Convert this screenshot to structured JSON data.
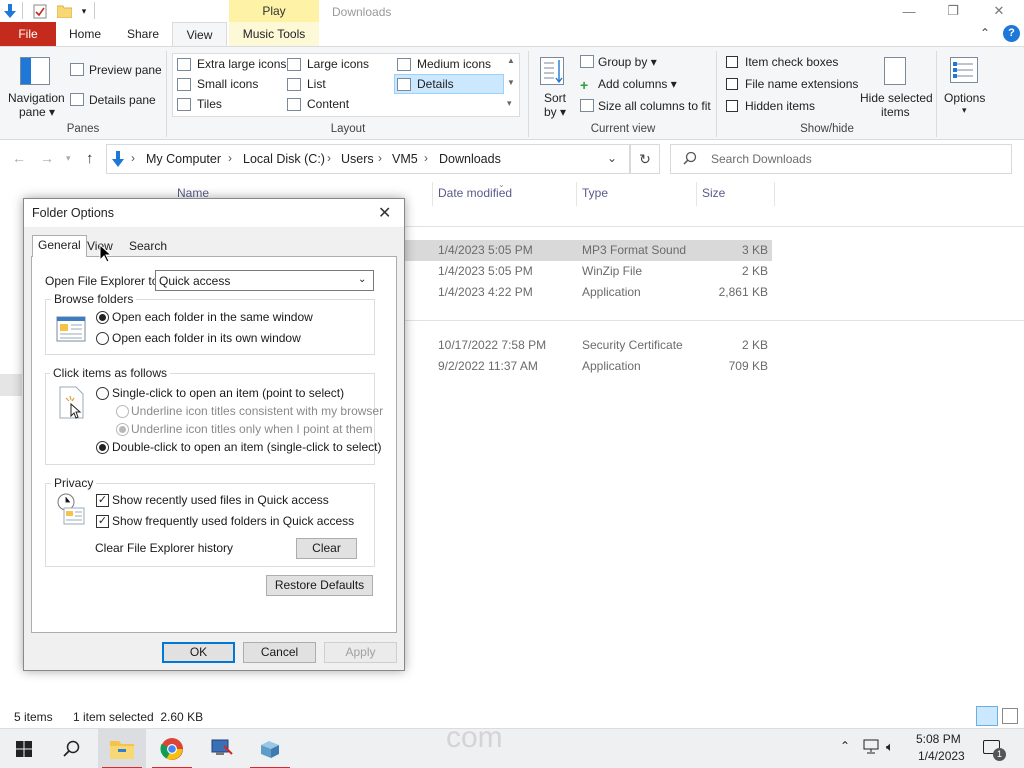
{
  "window": {
    "title": "Downloads",
    "contextual_tab_header": "Play",
    "minimize_icon": "—",
    "maximize_icon": "❐",
    "close_icon": "✕"
  },
  "ribbon_tabs": [
    "File",
    "Home",
    "Share",
    "View",
    "Music Tools"
  ],
  "ribbon": {
    "panes": {
      "group": "Panes",
      "navigation_pane": "Navigation\npane ▾",
      "navigation_pane_line1": "Navigation",
      "navigation_pane_line2": "pane ▾",
      "preview_pane": "Preview pane",
      "details_pane": "Details pane"
    },
    "layout": {
      "group": "Layout",
      "items": [
        "Extra large icons",
        "Large icons",
        "Medium icons",
        "Small icons",
        "List",
        "Details",
        "Tiles",
        "Content"
      ]
    },
    "current_view": {
      "group": "Current view",
      "sort_by_line1": "Sort",
      "sort_by_line2": "by ▾",
      "group_by": "Group by ▾",
      "add_columns": "Add columns ▾",
      "size_columns": "Size all columns to fit"
    },
    "show_hide": {
      "group": "Show/hide",
      "item_check_boxes": "Item check boxes",
      "file_name_extensions": "File name extensions",
      "hidden_items": "Hidden items",
      "hide_selected_line1": "Hide selected",
      "hide_selected_line2": "items",
      "options_line1": "Options",
      "options_line2": "▾"
    }
  },
  "address": {
    "crumbs": [
      "My Computer",
      "Local Disk (C:)",
      "Users",
      "VM5",
      "Downloads"
    ],
    "search_placeholder": "Search Downloads"
  },
  "columns": [
    "Name",
    "Date modified",
    "Type",
    "Size"
  ],
  "files": [
    {
      "date": "1/4/2023 5:05 PM",
      "type": "MP3 Format Sound",
      "size": "3 KB",
      "selected": true
    },
    {
      "date": "1/4/2023 5:05 PM",
      "type": "WinZip File",
      "size": "2 KB"
    },
    {
      "date": "1/4/2023 4:22 PM",
      "type": "Application",
      "size": "2,861 KB"
    },
    {
      "date": "10/17/2022 7:58 PM",
      "type": "Security Certificate",
      "size": "2 KB"
    },
    {
      "date": "9/2/2022 11:37 AM",
      "type": "Application",
      "size": "709 KB"
    }
  ],
  "status": {
    "items": "5 items",
    "selected": "1 item selected  2.60 KB"
  },
  "dialog": {
    "title": "Folder Options",
    "tabs": [
      "General",
      "View",
      "Search"
    ],
    "open_label": "Open File Explorer to:",
    "open_value": "Quick access",
    "browse": {
      "legend": "Browse folders",
      "same_window": "Open each folder in the same window",
      "own_window": "Open each folder in its own window"
    },
    "click": {
      "legend": "Click items as follows",
      "single": "Single-click to open an item (point to select)",
      "underline_browser": "Underline icon titles consistent with my browser",
      "underline_point": "Underline icon titles only when I point at them",
      "double": "Double-click to open an item (single-click to select)"
    },
    "privacy": {
      "legend": "Privacy",
      "recent_files": "Show recently used files in Quick access",
      "frequent_folders": "Show frequently used folders in Quick access",
      "clear_history": "Clear File Explorer history",
      "clear_button": "Clear"
    },
    "restore_defaults": "Restore Defaults",
    "ok": "OK",
    "cancel": "Cancel",
    "apply": "Apply"
  },
  "taskbar": {
    "clock_time": "5:08 PM",
    "clock_date": "1/4/2023",
    "watermark": "com",
    "notification_count": "1"
  },
  "colors": {
    "file_tab": "#c42b1c",
    "accent": "#0078d7",
    "play_tab": "#fdf2a6",
    "selection": "#d9d9d9"
  }
}
